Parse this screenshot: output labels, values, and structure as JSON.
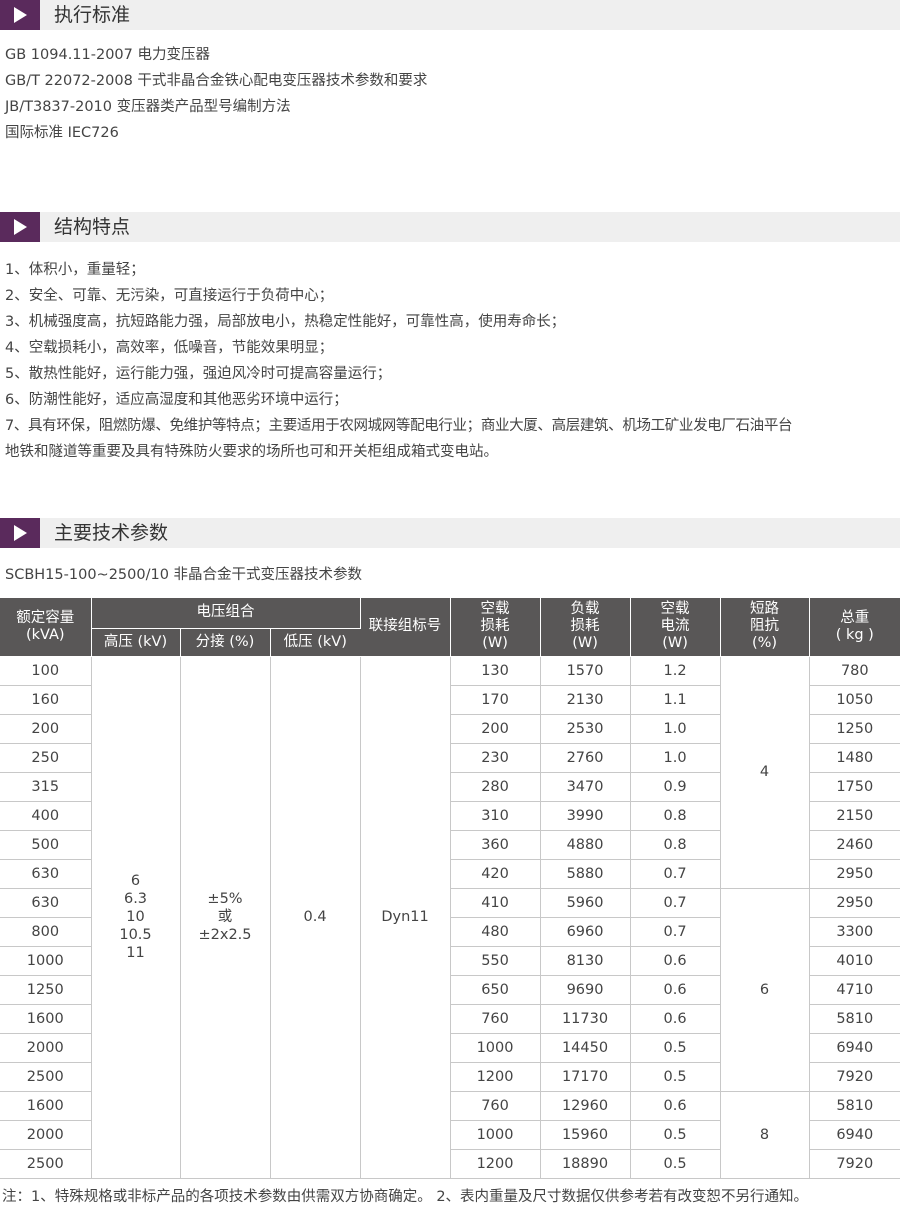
{
  "sections": {
    "standards": {
      "title": "执行标准",
      "lines": [
        "GB 1094.11-2007 电力变压器",
        "GB/T 22072-2008 干式非晶合金铁心配电变压器技术参数和要求",
        "JB/T3837-2010 变压器类产品型号编制方法",
        "国际标准 IEC726"
      ]
    },
    "features": {
      "title": "结构特点",
      "lines": [
        "1、体积小，重量轻；",
        "2、安全、可靠、无污染，可直接运行于负荷中心；",
        "3、机械强度高，抗短路能力强，局部放电小，热稳定性能好，可靠性高，使用寿命长；",
        "4、空载损耗小，高效率，低噪音，节能效果明显；",
        "5、散热性能好，运行能力强，强迫风冷时可提高容量运行；",
        "6、防潮性能好，适应高湿度和其他恶劣环境中运行；",
        "7、具有环保，阻燃防爆、免维护等特点；主要适用于农网城网等配电行业；商业大厦、高层建筑、机场工矿业发电厂石油平台",
        "地铁和隧道等重要及具有特殊防火要求的场所也可和开关柜组成箱式变电站。"
      ]
    },
    "params": {
      "title": "主要技术参数",
      "caption": "SCBH15-100~2500/10 非晶合金干式变压器技术参数"
    }
  },
  "table": {
    "headers": {
      "capacity_1": "额定容量",
      "capacity_2": "(kVA)",
      "voltage_group": "电压组合",
      "hv": "高压 (kV)",
      "tap": "分接 (%)",
      "lv": "低压 (kV)",
      "connection": "联接组标号",
      "noload_1": "空载",
      "noload_2": "损耗",
      "noload_3": "(W)",
      "load_1": "负载",
      "load_2": "损耗",
      "load_3": "(W)",
      "current_1": "空载",
      "current_2": "电流",
      "current_3": "(W)",
      "impedance_1": "短路",
      "impedance_2": "阻抗",
      "impedance_3": "(%)",
      "weight_1": "总重",
      "weight_2": "( kg )"
    },
    "merged": {
      "hv_values": [
        "6",
        "6.3",
        "10",
        "10.5",
        "11"
      ],
      "tap_1": "±5%",
      "tap_2": "或",
      "tap_3": "±2x2.5",
      "lv": "0.4",
      "connection": "Dyn11",
      "impedance_groups": [
        {
          "value": "4",
          "rows": 8
        },
        {
          "value": "6",
          "rows": 7
        },
        {
          "value": "8",
          "rows": 3
        }
      ]
    },
    "rows": [
      {
        "capacity": "100",
        "noload": "130",
        "load": "1570",
        "current": "1.2",
        "weight": "780"
      },
      {
        "capacity": "160",
        "noload": "170",
        "load": "2130",
        "current": "1.1",
        "weight": "1050"
      },
      {
        "capacity": "200",
        "noload": "200",
        "load": "2530",
        "current": "1.0",
        "weight": "1250"
      },
      {
        "capacity": "250",
        "noload": "230",
        "load": "2760",
        "current": "1.0",
        "weight": "1480"
      },
      {
        "capacity": "315",
        "noload": "280",
        "load": "3470",
        "current": "0.9",
        "weight": "1750"
      },
      {
        "capacity": "400",
        "noload": "310",
        "load": "3990",
        "current": "0.8",
        "weight": "2150"
      },
      {
        "capacity": "500",
        "noload": "360",
        "load": "4880",
        "current": "0.8",
        "weight": "2460"
      },
      {
        "capacity": "630",
        "noload": "420",
        "load": "5880",
        "current": "0.7",
        "weight": "2950"
      },
      {
        "capacity": "630",
        "noload": "410",
        "load": "5960",
        "current": "0.7",
        "weight": "2950"
      },
      {
        "capacity": "800",
        "noload": "480",
        "load": "6960",
        "current": "0.7",
        "weight": "3300"
      },
      {
        "capacity": "1000",
        "noload": "550",
        "load": "8130",
        "current": "0.6",
        "weight": "4010"
      },
      {
        "capacity": "1250",
        "noload": "650",
        "load": "9690",
        "current": "0.6",
        "weight": "4710"
      },
      {
        "capacity": "1600",
        "noload": "760",
        "load": "11730",
        "current": "0.6",
        "weight": "5810"
      },
      {
        "capacity": "2000",
        "noload": "1000",
        "load": "14450",
        "current": "0.5",
        "weight": "6940"
      },
      {
        "capacity": "2500",
        "noload": "1200",
        "load": "17170",
        "current": "0.5",
        "weight": "7920"
      },
      {
        "capacity": "1600",
        "noload": "760",
        "load": "12960",
        "current": "0.6",
        "weight": "5810"
      },
      {
        "capacity": "2000",
        "noload": "1000",
        "load": "15960",
        "current": "0.5",
        "weight": "6940"
      },
      {
        "capacity": "2500",
        "noload": "1200",
        "load": "18890",
        "current": "0.5",
        "weight": "7920"
      }
    ]
  },
  "note": "注：1、特殊规格或非标产品的各项技术参数由供需双方协商确定。 2、表内重量及尺寸数据仅供参考若有改变恕不另行通知。"
}
